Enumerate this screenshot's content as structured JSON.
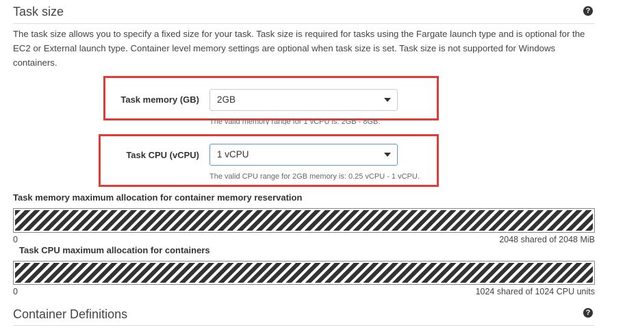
{
  "task_size": {
    "title": "Task size",
    "help_icon": "question-circle-icon",
    "description": "The task size allows you to specify a fixed size for your task. Task size is required for tasks using the Fargate launch type and is optional for the EC2 or External launch type. Container level memory settings are optional when task size is set. Task size is not supported for Windows containers."
  },
  "memory": {
    "label": "Task memory (GB)",
    "value": "2GB",
    "hint": "The valid memory range for 1 vCPU is: 2GB - 8GB."
  },
  "cpu": {
    "label": "Task CPU (vCPU)",
    "value": "1 vCPU",
    "hint": "The valid CPU range for 2GB memory is: 0.25 vCPU - 1 vCPU."
  },
  "memory_allocation": {
    "label": "Task memory maximum allocation for container memory reservation",
    "min": "0",
    "summary": "2048 shared of 2048 MiB",
    "fill_fraction": 1.0
  },
  "cpu_allocation": {
    "label": "Task CPU maximum allocation for containers",
    "min": "0",
    "summary": "1024 shared of 1024 CPU units",
    "fill_fraction": 1.0
  },
  "container_definitions": {
    "title": "Container Definitions",
    "help_icon": "question-circle-icon"
  },
  "colors": {
    "highlight_border": "#e53935",
    "focus_border": "#5a9ad6",
    "stripe_dark": "#333333"
  }
}
